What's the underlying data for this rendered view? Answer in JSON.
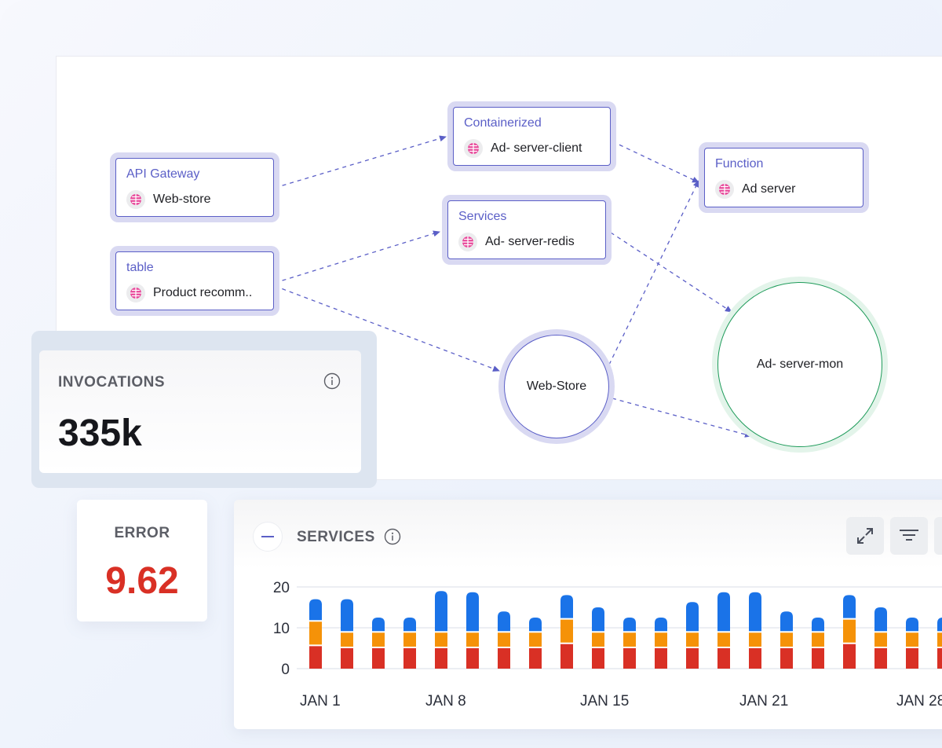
{
  "diagram": {
    "nodes": [
      {
        "id": "api-gateway",
        "category": "API Gateway",
        "name": "Web-store",
        "icon": "globe-icon"
      },
      {
        "id": "table",
        "category": "table",
        "name": "Product recomm..",
        "icon": "globe-icon"
      },
      {
        "id": "containerized",
        "category": "Containerized",
        "name": "Ad- server-client",
        "icon": "globe-icon"
      },
      {
        "id": "services",
        "category": "Services",
        "name": "Ad- server-redis",
        "icon": "globe-icon"
      },
      {
        "id": "function",
        "category": "Function",
        "name": "Ad server",
        "icon": "globe-icon"
      }
    ],
    "circles": [
      {
        "id": "web-store",
        "label": "Web-Store"
      },
      {
        "id": "ad-server-mon",
        "label": "Ad- server-mon"
      }
    ],
    "edges": [
      {
        "from": "api-gateway",
        "to": "containerized"
      },
      {
        "from": "table",
        "to": "services"
      },
      {
        "from": "table",
        "to": "web-store"
      },
      {
        "from": "containerized",
        "to": "function"
      },
      {
        "from": "services",
        "to": "ad-server-mon"
      },
      {
        "from": "web-store",
        "to": "function"
      },
      {
        "from": "web-store",
        "to": "ad-server-mon"
      }
    ],
    "colors": {
      "node_border": "#5b5fc7",
      "node_halo": "#d9d9f2",
      "mon_border": "#1e9b5a",
      "mon_halo": "#e3f4ea",
      "globe": "#e8479a"
    }
  },
  "invocations": {
    "title": "INVOCATIONS",
    "value": "335k",
    "info_icon": "info-icon"
  },
  "error": {
    "title": "ERROR",
    "value": "9.62",
    "value_color": "#d93025"
  },
  "services_panel": {
    "title": "SERVICES",
    "collapse_icon": "minus-icon",
    "info_icon": "info-icon",
    "tools": [
      "expand-icon",
      "filter-icon"
    ]
  },
  "chart_data": {
    "type": "bar",
    "stacked": true,
    "title": "SERVICES",
    "xlabel": "",
    "ylabel": "",
    "ylim": [
      0,
      20
    ],
    "yticks": [
      "0",
      "10",
      "20"
    ],
    "xtick_labels": [
      {
        "label": "JAN 1",
        "index": 0
      },
      {
        "label": "JAN 8",
        "index": 4
      },
      {
        "label": "JAN 15",
        "index": 9
      },
      {
        "label": "JAN 21",
        "index": 14
      },
      {
        "label": "JAN 28",
        "index": 19
      }
    ],
    "grid": true,
    "categories": [
      "1",
      "2",
      "3",
      "4",
      "5",
      "6",
      "7",
      "8",
      "9",
      "10",
      "11",
      "12",
      "13",
      "14",
      "15",
      "16",
      "17",
      "18",
      "19",
      "20",
      "21"
    ],
    "series": [
      {
        "name": "red",
        "color": "#d93025",
        "values": [
          5.5,
          5,
          5,
          5,
          5,
          5,
          5,
          5,
          6,
          5,
          5,
          5,
          5,
          5,
          5,
          5,
          5,
          6,
          5,
          5,
          5
        ]
      },
      {
        "name": "orange",
        "color": "#f59208",
        "values": [
          6,
          3.8,
          3.8,
          3.8,
          3.8,
          3.8,
          3.8,
          3.8,
          6,
          3.8,
          3.8,
          3.8,
          3.8,
          3.8,
          3.8,
          3.8,
          3.8,
          6,
          3.8,
          3.8,
          3.8
        ]
      },
      {
        "name": "blue",
        "color": "#1a73e8",
        "values": [
          5.5,
          8.2,
          3.7,
          3.7,
          10.2,
          9.9,
          5.2,
          3.7,
          6,
          6.2,
          3.7,
          3.7,
          7.5,
          9.9,
          9.9,
          5.2,
          3.7,
          6,
          6.2,
          3.7,
          3.7
        ]
      }
    ]
  }
}
